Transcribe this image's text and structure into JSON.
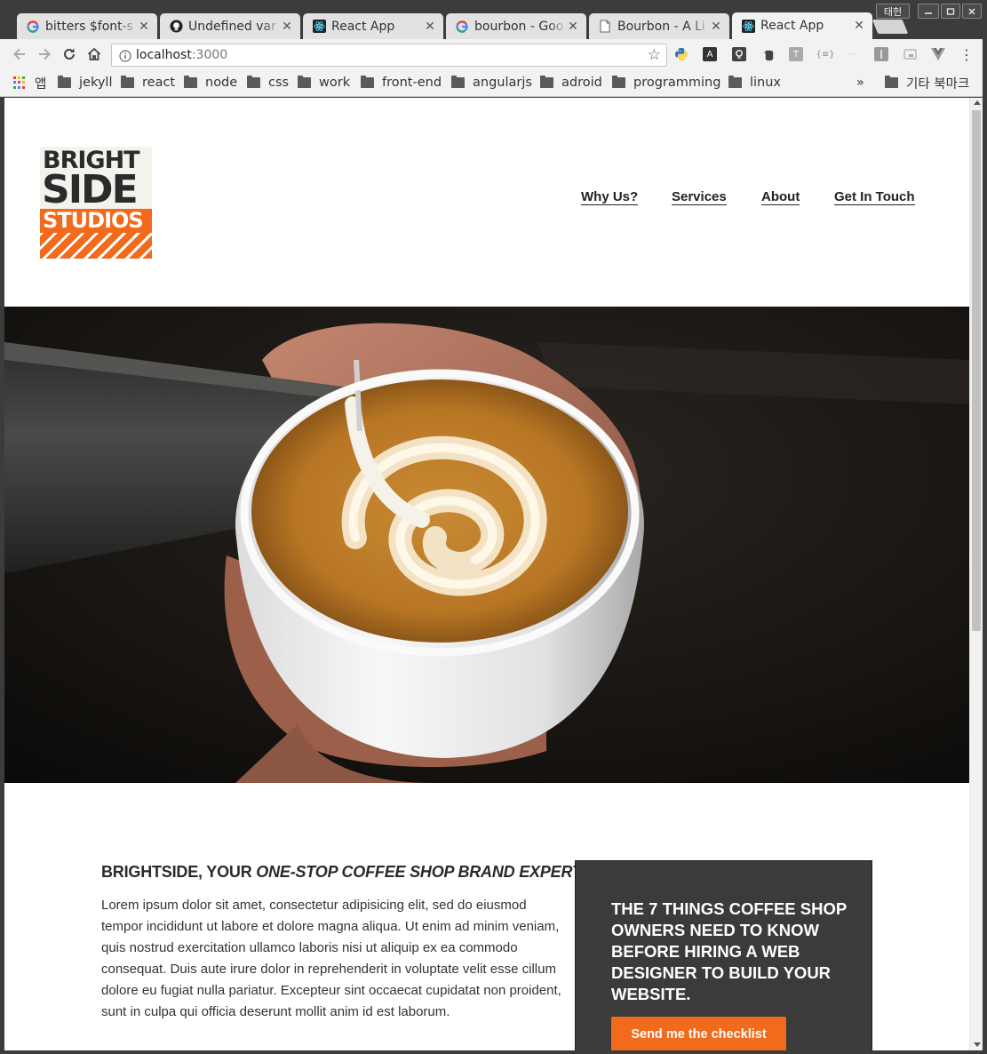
{
  "browser": {
    "profile_name": "태헌",
    "tabs": [
      {
        "title": "bitters $font-s",
        "favicon": "google-icon",
        "active": false
      },
      {
        "title": "Undefined var",
        "favicon": "github-icon",
        "active": false
      },
      {
        "title": "React App",
        "favicon": "react-icon",
        "active": false
      },
      {
        "title": "bourbon - Goo",
        "favicon": "google-icon",
        "active": false
      },
      {
        "title": "Bourbon - A Li",
        "favicon": "page-icon",
        "active": false
      },
      {
        "title": "React App",
        "favicon": "react-icon",
        "active": true
      }
    ],
    "address": {
      "host": "localhost",
      "port": ":3000"
    },
    "bookmarks": {
      "apps_label": "앱",
      "folders": [
        "jekyll",
        "react",
        "node",
        "css",
        "work",
        "front-end",
        "angularjs",
        "adroid",
        "programming",
        "linux"
      ],
      "overflow": "»",
      "other_label": "기타 북마크"
    }
  },
  "site": {
    "logo": {
      "line1": "BRIGHT",
      "line2": "SIDE",
      "line3": "STUDIOS"
    },
    "nav": [
      "Why Us?",
      "Services",
      "About",
      "Get In Touch"
    ],
    "hero_alt": "coffee-cup-latte-art",
    "headline": {
      "normal": "BRIGHTSIDE, YOUR ",
      "emphasis": "ONE-STOP COFFEE SHOP BRAND EXPERTS"
    },
    "body": "Lorem ipsum dolor sit amet, consectetur adipisicing elit, sed do eiusmod tempor incididunt ut labore et dolore magna aliqua. Ut enim ad minim veniam, quis nostrud exercitation ullamco laboris nisi ut aliquip ex ea commodo consequat. Duis aute irure dolor in reprehenderit in voluptate velit esse cillum dolore eu fugiat nulla pariatur. Excepteur sint occaecat cupidatat non proident, sunt in culpa qui officia deserunt mollit anim id est laborum.",
    "cta": {
      "title": "The 7 things coffee shop owners need to know before hiring a web designer to build your website.",
      "button": "Send me the checklist"
    }
  },
  "colors": {
    "brand_orange": "#f26a1b",
    "dark_panel": "#3b3b3b",
    "chrome_frame": "#3c3c3c"
  }
}
